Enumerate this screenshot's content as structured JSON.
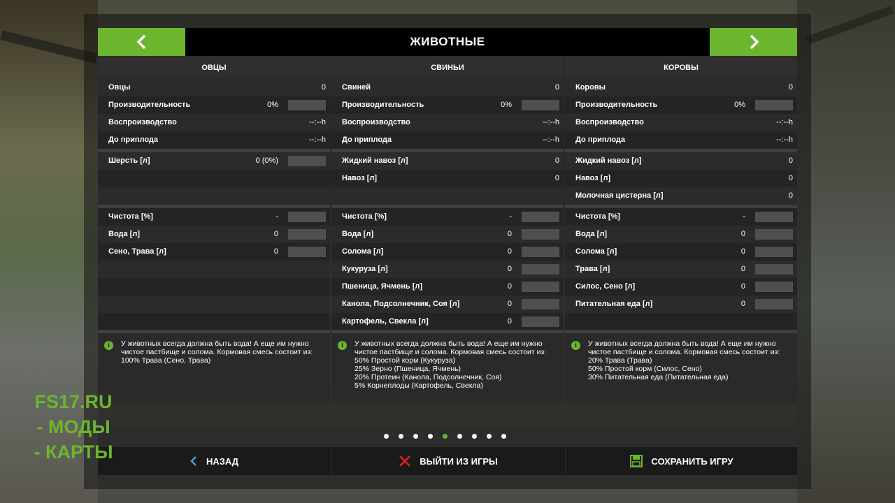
{
  "header": {
    "title": "ЖИВОТНЫЕ"
  },
  "columns": [
    {
      "title": "ОВЦЫ",
      "rows": [
        {
          "label": "Овцы",
          "value": "0",
          "bar": false,
          "empty": false
        },
        {
          "label": "Производительность",
          "value": "0%",
          "bar": true,
          "empty": false
        },
        {
          "label": "Воспроизводство",
          "value": "--:--h",
          "bar": false,
          "empty": false
        },
        {
          "label": "До приплода",
          "value": "--:--h",
          "bar": false,
          "empty": false
        },
        {
          "label": "Шерсть [л]",
          "value": "0 (0%)",
          "bar": true,
          "empty": false
        },
        {
          "label": "",
          "value": "",
          "bar": false,
          "empty": true
        },
        {
          "label": "",
          "value": "",
          "bar": false,
          "empty": true
        },
        {
          "label": "Чистота [%]",
          "value": "-",
          "bar": true,
          "empty": false
        },
        {
          "label": "Вода [л]",
          "value": "0",
          "bar": true,
          "empty": false
        },
        {
          "label": "Сено, Трава [л]",
          "value": "0",
          "bar": true,
          "empty": false
        },
        {
          "label": "",
          "value": "",
          "bar": false,
          "empty": true
        },
        {
          "label": "",
          "value": "",
          "bar": false,
          "empty": true
        },
        {
          "label": "",
          "value": "",
          "bar": false,
          "empty": true
        },
        {
          "label": "",
          "value": "",
          "bar": false,
          "empty": true
        }
      ],
      "info": "У животных всегда должна быть вода! А еще им нужно чистое пастбище и солома. Кормовая смесь состоит из:\n100% Трава (Сено, Трава)"
    },
    {
      "title": "СВИНЬИ",
      "rows": [
        {
          "label": "Свиней",
          "value": "0",
          "bar": false,
          "empty": false
        },
        {
          "label": "Производительность",
          "value": "0%",
          "bar": true,
          "empty": false
        },
        {
          "label": "Воспроизводство",
          "value": "--:--h",
          "bar": false,
          "empty": false
        },
        {
          "label": "До приплода",
          "value": "--:--h",
          "bar": false,
          "empty": false
        },
        {
          "label": "Жидкий навоз [л]",
          "value": "0",
          "bar": false,
          "empty": false
        },
        {
          "label": "Навоз [л]",
          "value": "0",
          "bar": false,
          "empty": false
        },
        {
          "label": "",
          "value": "",
          "bar": false,
          "empty": true
        },
        {
          "label": "Чистота [%]",
          "value": "-",
          "bar": true,
          "empty": false
        },
        {
          "label": "Вода [л]",
          "value": "0",
          "bar": true,
          "empty": false
        },
        {
          "label": "Солома [л]",
          "value": "0",
          "bar": true,
          "empty": false
        },
        {
          "label": "Кукуруза [л]",
          "value": "0",
          "bar": true,
          "empty": false
        },
        {
          "label": "Пшеница, Ячмень [л]",
          "value": "0",
          "bar": true,
          "empty": false
        },
        {
          "label": "Канола, Подсолнечник, Соя [л]",
          "value": "0",
          "bar": true,
          "empty": false
        },
        {
          "label": "Картофель, Свекла [л]",
          "value": "0",
          "bar": true,
          "empty": false
        }
      ],
      "info": "У животных всегда должна быть вода! А еще им нужно чистое пастбище и солома. Кормовая смесь состоит из:\n50% Простой корм (Кукуруза)\n25% Зерно (Пшеница, Ячмень)\n20% Протеин (Канола, Подсолнечник, Соя)\n5% Корнеплоды (Картофель, Свекла)"
    },
    {
      "title": "КОРОВЫ",
      "rows": [
        {
          "label": "Коровы",
          "value": "0",
          "bar": false,
          "empty": false
        },
        {
          "label": "Производительность",
          "value": "0%",
          "bar": true,
          "empty": false
        },
        {
          "label": "Воспроизводство",
          "value": "--:--h",
          "bar": false,
          "empty": false
        },
        {
          "label": "До приплода",
          "value": "--:--h",
          "bar": false,
          "empty": false
        },
        {
          "label": "Жидкий навоз [л]",
          "value": "0",
          "bar": false,
          "empty": false
        },
        {
          "label": "Навоз [л]",
          "value": "0",
          "bar": false,
          "empty": false
        },
        {
          "label": "Молочная цистерна [л]",
          "value": "0",
          "bar": false,
          "empty": false
        },
        {
          "label": "Чистота [%]",
          "value": "-",
          "bar": true,
          "empty": false
        },
        {
          "label": "Вода [л]",
          "value": "0",
          "bar": true,
          "empty": false
        },
        {
          "label": "Солома [л]",
          "value": "0",
          "bar": true,
          "empty": false
        },
        {
          "label": "Трава [л]",
          "value": "0",
          "bar": true,
          "empty": false
        },
        {
          "label": "Силос, Сено [л]",
          "value": "0",
          "bar": true,
          "empty": false
        },
        {
          "label": "Питательная еда [л]",
          "value": "0",
          "bar": true,
          "empty": false
        },
        {
          "label": "",
          "value": "",
          "bar": false,
          "empty": true
        }
      ],
      "info": "У животных всегда должна быть вода! А еще им нужно чистое пастбище и солома. Кормовая смесь состоит из:\n20% Трава (Трава)\n50% Простой корм (Силос, Сено)\n30% Питательная еда (Питательная еда)"
    }
  ],
  "pagination": {
    "count": 9,
    "active_index": 4
  },
  "footer": {
    "back_label": "НАЗАД",
    "quit_label": "ВЫЙТИ ИЗ ИГРЫ",
    "save_label": "СОХРАНИТЬ ИГРУ"
  },
  "watermark": {
    "line1": "FS17.RU",
    "line2": "- МОДЫ",
    "line3": "- КАРТЫ"
  },
  "colors": {
    "accent": "#6cb52e",
    "back_icon": "#3aa7d8",
    "quit_icon": "#e0261b",
    "save_icon": "#6cb52e"
  },
  "icons": {
    "prev": "chevron-left-icon",
    "next": "chevron-right-icon",
    "info": "info-icon",
    "back": "chevron-left-icon",
    "quit": "close-icon",
    "save": "floppy-disk-icon"
  }
}
